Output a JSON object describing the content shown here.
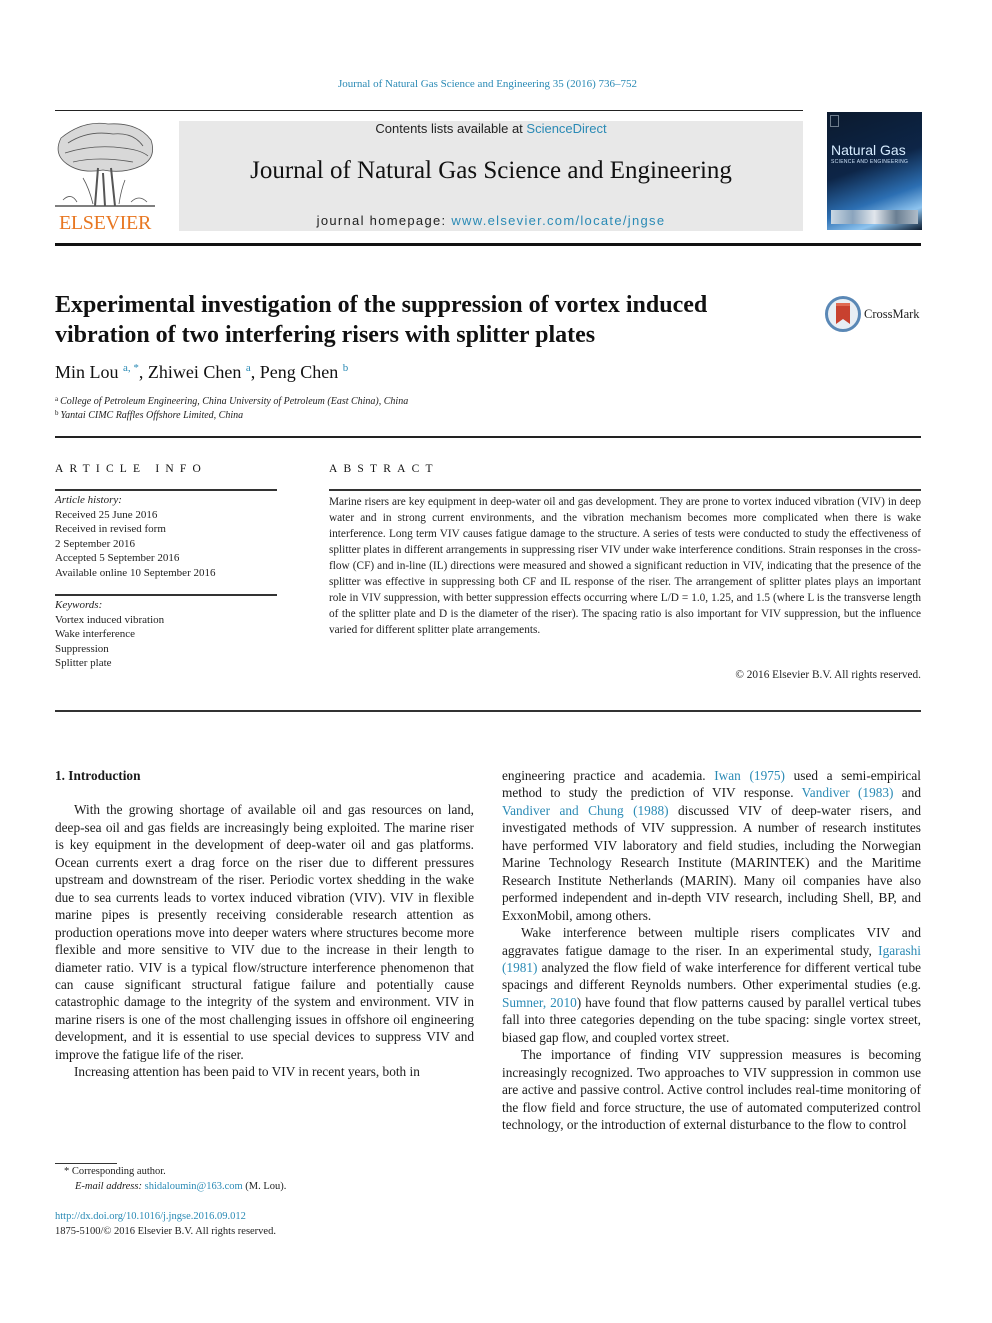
{
  "running_head": "Journal of Natural Gas Science and Engineering 35 (2016) 736–752",
  "header": {
    "publisher_logo_text": "ELSEVIER",
    "contents_prefix": "Contents lists available at ",
    "contents_link": "ScienceDirect",
    "journal_name": "Journal of Natural Gas Science and Engineering",
    "homepage_prefix": "journal homepage: ",
    "homepage_link": "www.elsevier.com/locate/jngse",
    "cover_title": "Natural Gas",
    "cover_subtitle": "SCIENCE AND ENGINEERING"
  },
  "article": {
    "title": "Experimental investigation of the suppression of vortex induced vibration of two interfering risers with splitter plates",
    "crossmark_label": "CrossMark",
    "authors": [
      {
        "name": "Min Lou",
        "sup": "a, *"
      },
      {
        "name": "Zhiwei Chen",
        "sup": "a"
      },
      {
        "name": "Peng Chen",
        "sup": "b"
      }
    ],
    "affiliations": [
      {
        "mark": "a",
        "text": "College of Petroleum Engineering, China University of Petroleum (East China), China"
      },
      {
        "mark": "b",
        "text": "Yantai CIMC Raffles Offshore Limited, China"
      }
    ]
  },
  "article_info": {
    "heading": "ARTICLE INFO",
    "history_label": "Article history:",
    "history": [
      "Received 25 June 2016",
      "Received in revised form",
      "2 September 2016",
      "Accepted 5 September 2016",
      "Available online 10 September 2016"
    ],
    "keywords_label": "Keywords:",
    "keywords": [
      "Vortex induced vibration",
      "Wake interference",
      "Suppression",
      "Splitter plate"
    ]
  },
  "abstract": {
    "heading": "ABSTRACT",
    "text": "Marine risers are key equipment in deep-water oil and gas development. They are prone to vortex induced vibration (VIV) in deep water and in strong current environments, and the vibration mechanism becomes more complicated when there is wake interference. Long term VIV causes fatigue damage to the structure. A series of tests were conducted to study the effectiveness of splitter plates in different arrangements in suppressing riser VIV under wake interference conditions. Strain responses in the cross-flow (CF) and in-line (IL) directions were measured and showed a significant reduction in VIV, indicating that the presence of the splitter was effective in suppressing both CF and IL response of the riser. The arrangement of splitter plates plays an important role in VIV suppression, with better suppression effects occurring where L/D = 1.0, 1.25, and 1.5 (where L is the transverse length of the splitter plate and D is the diameter of the riser). The spacing ratio is also important for VIV suppression, but the influence varied for different splitter plate arrangements.",
    "copyright": "© 2016 Elsevier B.V. All rights reserved."
  },
  "body": {
    "section_heading": "1.  Introduction",
    "left_p1": "With the growing shortage of available oil and gas resources on land, deep-sea oil and gas fields are increasingly being exploited. The marine riser is key equipment in the development of deep-water oil and gas platforms. Ocean currents exert a drag force on the riser due to different pressures upstream and downstream of the riser. Periodic vortex shedding in the wake due to sea currents leads to vortex induced vibration (VIV). VIV in flexible marine pipes is presently receiving considerable research attention as production operations move into deeper waters where structures become more flexible and more sensitive to VIV due to the increase in their length to diameter ratio. VIV is a typical flow/structure interference phenomenon that can cause significant structural fatigue failure and potentially cause catastrophic damage to the integrity of the system and environment. VIV in marine risers is one of the most challenging issues in offshore oil engineering development, and it is essential to use special devices to suppress VIV and improve the fatigue life of the riser.",
    "left_p2": "Increasing attention has been paid to VIV in recent years, both in",
    "right_p1": {
      "t1": "engineering practice and academia. ",
      "ref1": "Iwan (1975)",
      "t2": " used a semi-empirical method to study the prediction of VIV response. ",
      "ref2": "Vandiver (1983)",
      "t3": " and ",
      "ref3": "Vandiver and Chung (1988)",
      "t4": " discussed VIV of deep-water risers, and investigated methods of VIV suppression. A number of research institutes have performed VIV laboratory and field studies, including the Norwegian Marine Technology Research Institute (MARINTEK) and the Maritime Research Institute Netherlands (MARIN). Many oil companies have also performed independent and in-depth VIV research, including Shell, BP, and ExxonMobil, among others."
    },
    "right_p2": {
      "t1": "Wake interference between multiple risers complicates VIV and aggravates fatigue damage to the riser. In an experimental study, ",
      "ref1": "Igarashi (1981)",
      "t2": " analyzed the flow field of wake interference for different vertical tube spacings and different Reynolds numbers. Other experimental studies (e.g. ",
      "ref2": "Sumner, 2010",
      "t3": ") have found that flow patterns caused by parallel vertical tubes fall into three categories depending on the tube spacing: single vortex street, biased gap flow, and coupled vortex street."
    },
    "right_p3": "The importance of finding VIV suppression measures is becoming increasingly recognized. Two approaches to VIV suppression in common use are active and passive control. Active control includes real-time monitoring of the flow field and force structure, the use of automated computerized control technology, or the introduction of external disturbance to the flow to control"
  },
  "footnotes": {
    "corresponding": "* Corresponding author.",
    "email_label": "E-mail address: ",
    "email": "shidaloumin@163.com",
    "email_suffix": " (M. Lou).",
    "doi": "http://dx.doi.org/10.1016/j.jngse.2016.09.012",
    "issn": "1875-5100/© 2016 Elsevier B.V. All rights reserved."
  }
}
